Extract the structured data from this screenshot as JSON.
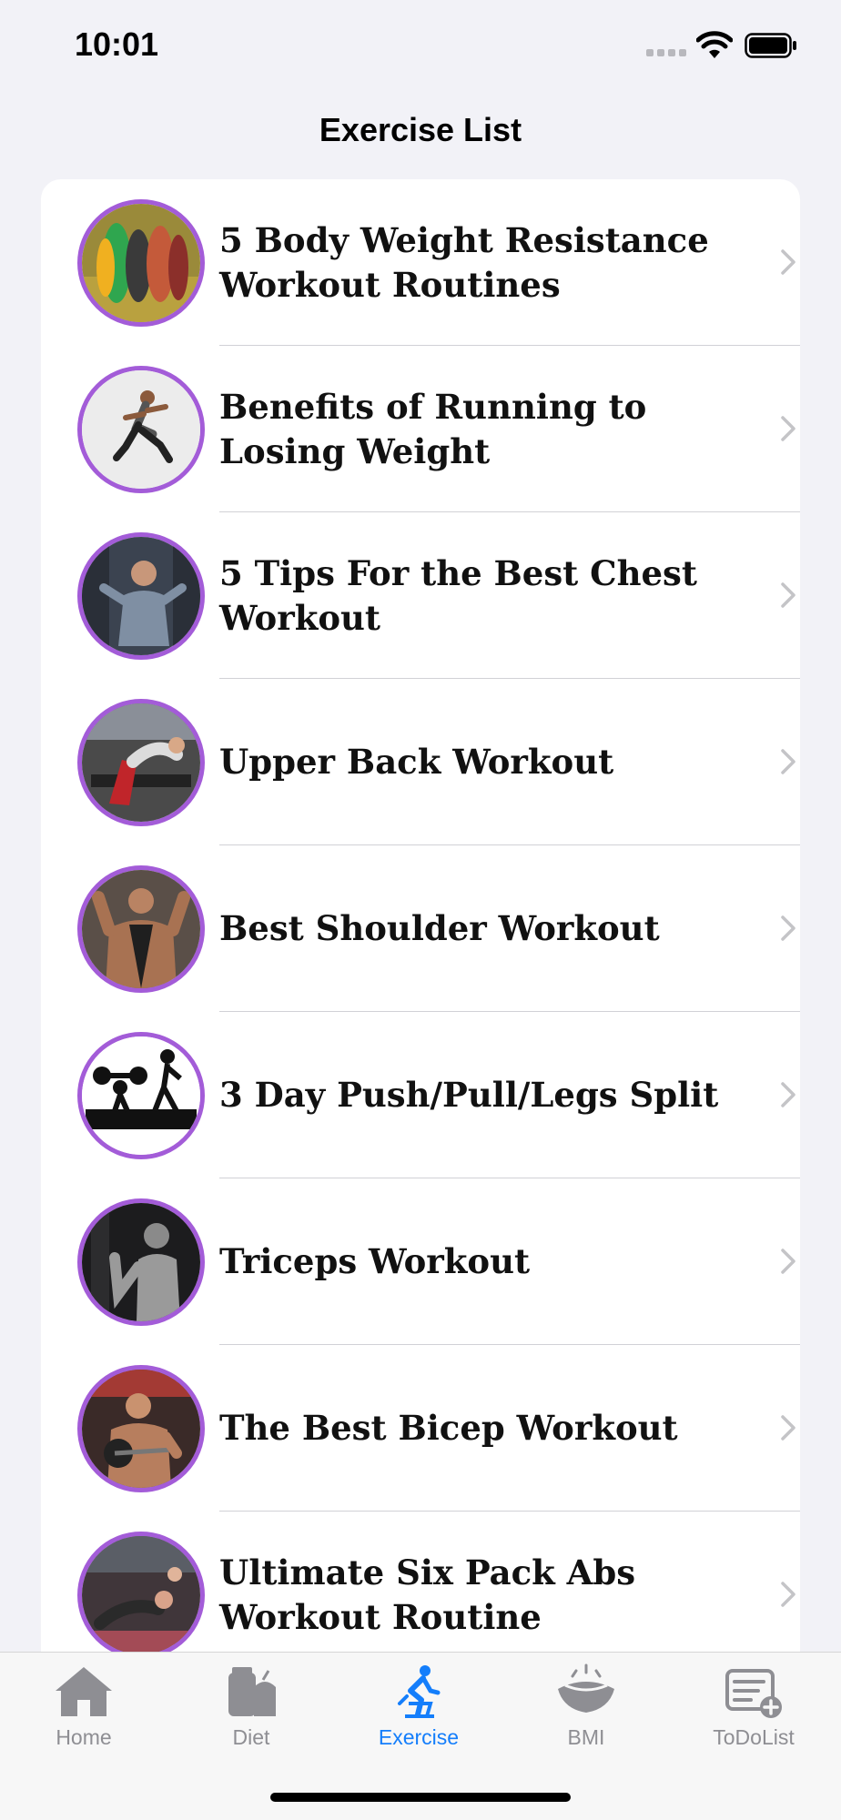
{
  "status_bar": {
    "time": "10:01"
  },
  "nav": {
    "title": "Exercise List"
  },
  "exercises": [
    {
      "title": "5 Body Weight Resistance Workout Routines"
    },
    {
      "title": "Benefits of Running to Losing Weight"
    },
    {
      "title": "5 Tips For the Best Chest Workout"
    },
    {
      "title": "Upper Back Workout"
    },
    {
      "title": "Best Shoulder Workout"
    },
    {
      "title": "3 Day Push/Pull/Legs Split"
    },
    {
      "title": "Triceps Workout"
    },
    {
      "title": "The Best Bicep Workout"
    },
    {
      "title": "Ultimate Six Pack Abs Workout Routine"
    }
  ],
  "tab_bar": {
    "tabs": [
      {
        "label": "Home",
        "icon": "house-icon"
      },
      {
        "label": "Diet",
        "icon": "diet-icon"
      },
      {
        "label": "Exercise",
        "icon": "cycling-icon"
      },
      {
        "label": "BMI",
        "icon": "scale-icon"
      },
      {
        "label": "ToDoList",
        "icon": "todo-list-icon"
      }
    ],
    "selected": "Exercise"
  },
  "colors": {
    "accent": "#147efb",
    "thumbnail_ring": "#a35cd8",
    "inactive_tab": "#8e8e93",
    "background": "#f2f2f7"
  }
}
